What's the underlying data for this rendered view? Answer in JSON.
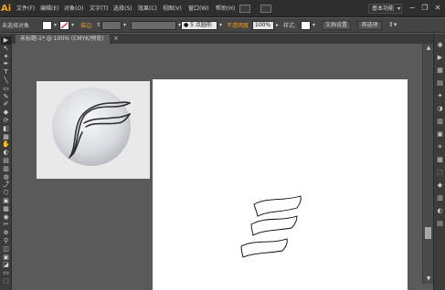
{
  "app": {
    "logo": "Ai"
  },
  "menu": {
    "items": [
      "文件(F)",
      "编辑(E)",
      "对象(O)",
      "文字(T)",
      "选择(S)",
      "效果(C)",
      "视图(V)",
      "窗口(W)",
      "帮助(H)"
    ]
  },
  "workspace": {
    "label": "基本功能",
    "arrow": "▾"
  },
  "window_controls": {
    "minimize": "−",
    "restore": "❐",
    "close": "✕"
  },
  "control_bar": {
    "selection_label": "未选择对象",
    "stroke_label": "描边:",
    "brush_value": "●  5 点圆形",
    "opacity_label": "不透明度",
    "opacity_value": "100%",
    "style_label": "样式:",
    "doc_setup_button": "文档设置",
    "preferences_button": "首选项",
    "more_icon": "⇕▾"
  },
  "document": {
    "tab_label": "未标题-1* @ 100% (CMYK/预览)",
    "close_glyph": "×"
  },
  "toolbar": {
    "tools": [
      "▶",
      "↖",
      "✦",
      "✒",
      "T",
      "╲",
      "▭",
      "✎",
      "✐",
      "◆",
      "⟳",
      "◧",
      "▦",
      "✋",
      "◐",
      "▤",
      "▥",
      "◍",
      "⤴",
      "⬡",
      "▣",
      "▦",
      "◉",
      "✂",
      "⊕",
      "⚲",
      "◫",
      "▣",
      "◪",
      "▭",
      "⬚"
    ]
  },
  "right_panel": {
    "icons": [
      "◉",
      "▶",
      "▦",
      "▤",
      "✦",
      "◑",
      "▥",
      "▣",
      "☀",
      "▩",
      "⬚",
      "◆",
      "▥",
      "◐",
      "▤"
    ]
  },
  "scrollbar": {
    "up": "▲",
    "down": "▼"
  },
  "icons": {
    "logo": "ai-logo-icon",
    "brush": "brush-icon",
    "scroll_up": "up-arrow-icon",
    "scroll_down": "down-arrow-icon"
  },
  "colors": {
    "accent": "#f29b1c",
    "menubar_bg": "#2e2e2e",
    "canvas_bg": "#5a5a5a",
    "artboard": "#ffffff"
  }
}
